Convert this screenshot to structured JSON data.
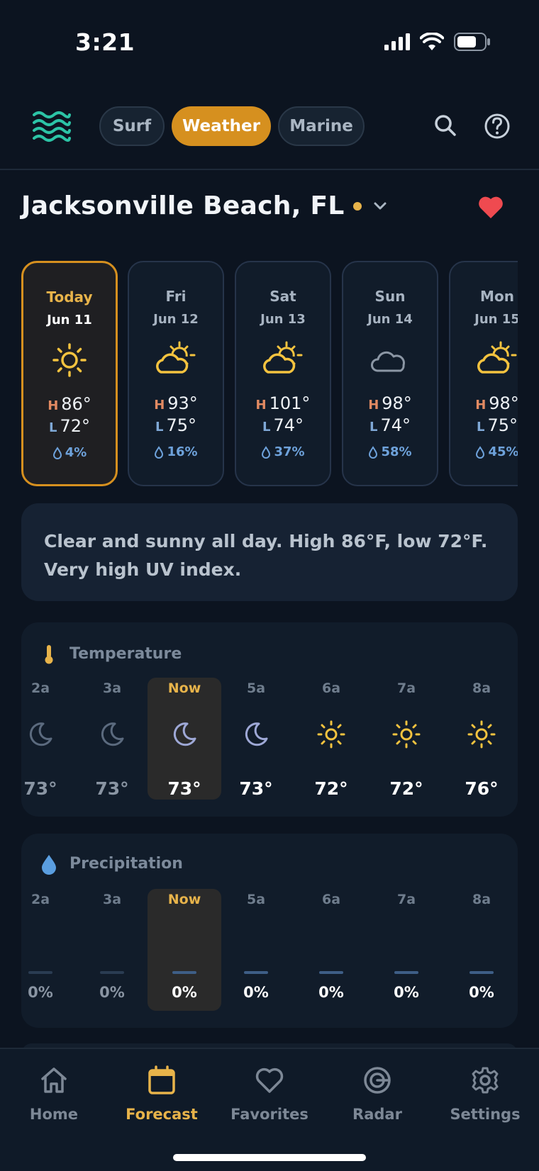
{
  "status": {
    "time": "3:21"
  },
  "nav": {
    "tabs": [
      {
        "label": "Surf",
        "active": false
      },
      {
        "label": "Weather",
        "active": true
      },
      {
        "label": "Marine",
        "active": false
      }
    ]
  },
  "location": {
    "name": "Jacksonville Beach, FL"
  },
  "days": [
    {
      "name": "Today",
      "date": "Jun 11",
      "icon": "sun-icon",
      "high": "86°",
      "low": "72°",
      "precip": "4%"
    },
    {
      "name": "Fri",
      "date": "Jun 12",
      "icon": "partly-cloudy-icon",
      "high": "93°",
      "low": "75°",
      "precip": "16%"
    },
    {
      "name": "Sat",
      "date": "Jun 13",
      "icon": "partly-cloudy-icon",
      "high": "101°",
      "low": "74°",
      "precip": "37%"
    },
    {
      "name": "Sun",
      "date": "Jun 14",
      "icon": "cloud-icon",
      "high": "98°",
      "low": "74°",
      "precip": "58%"
    },
    {
      "name": "Mon",
      "date": "Jun 15",
      "icon": "partly-cloudy-icon",
      "high": "98°",
      "low": "75°",
      "precip": "45%"
    }
  ],
  "day_labels": {
    "high": "H",
    "low": "L"
  },
  "summary": "Clear and sunny all day. High 86°F, low 72°F. Very high UV index.",
  "temperature": {
    "title": "Temperature",
    "hours": [
      {
        "label": "2a",
        "icon": "moon-icon",
        "temp": "73°"
      },
      {
        "label": "3a",
        "icon": "moon-icon",
        "temp": "73°"
      },
      {
        "label": "Now",
        "icon": "moon-icon",
        "temp": "73°"
      },
      {
        "label": "5a",
        "icon": "moon-icon",
        "temp": "73°"
      },
      {
        "label": "6a",
        "icon": "sun-icon",
        "temp": "72°"
      },
      {
        "label": "7a",
        "icon": "sun-icon",
        "temp": "72°"
      },
      {
        "label": "8a",
        "icon": "sun-icon",
        "temp": "76°"
      }
    ]
  },
  "precipitation": {
    "title": "Precipitation",
    "hours": [
      {
        "label": "2a",
        "value": "0%"
      },
      {
        "label": "3a",
        "value": "0%"
      },
      {
        "label": "Now",
        "value": "0%"
      },
      {
        "label": "5a",
        "value": "0%"
      },
      {
        "label": "6a",
        "value": "0%"
      },
      {
        "label": "7a",
        "value": "0%"
      },
      {
        "label": "8a",
        "value": "0%"
      }
    ]
  },
  "tabbar": [
    {
      "label": "Home",
      "icon": "home-icon",
      "active": false
    },
    {
      "label": "Forecast",
      "icon": "calendar-icon",
      "active": true
    },
    {
      "label": "Favorites",
      "icon": "heart-icon",
      "active": false
    },
    {
      "label": "Radar",
      "icon": "radar-icon",
      "active": false
    },
    {
      "label": "Settings",
      "icon": "gear-icon",
      "active": false
    }
  ],
  "colors": {
    "accent": "#d6901f",
    "accent_text": "#e7b34a",
    "background": "#0c1420",
    "heart": "#ef4a50",
    "precip": "#6ea2db"
  }
}
